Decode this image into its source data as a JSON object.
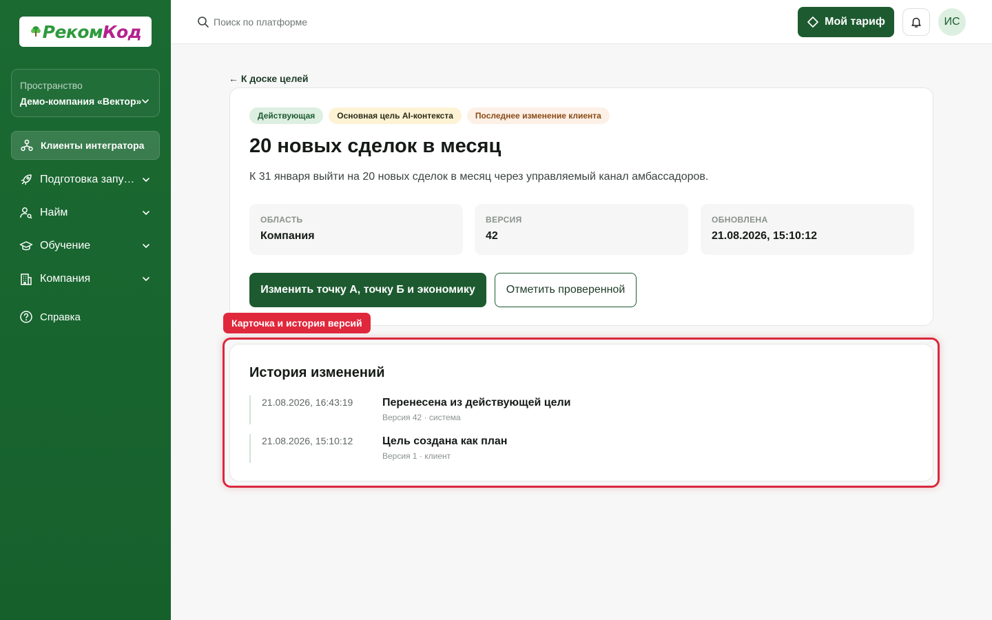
{
  "brand": {
    "logo_part1": "Реком",
    "logo_part2": "Код"
  },
  "sidebar": {
    "space_label": "Пространство",
    "space_value": "Демо-компания «Вектор»",
    "items": [
      {
        "label": "Клиенты интегратора",
        "icon": "users-network-icon",
        "active": true
      },
      {
        "label": "Подготовка запуска",
        "icon": "rocket-icon",
        "expandable": true
      },
      {
        "label": "Найм",
        "icon": "user-search-icon",
        "expandable": true
      },
      {
        "label": "Обучение",
        "icon": "graduation-cap-icon",
        "expandable": true
      },
      {
        "label": "Компания",
        "icon": "building-icon",
        "expandable": true
      },
      {
        "label": "Справка",
        "icon": "help-circle-icon"
      }
    ]
  },
  "topbar": {
    "search_placeholder": "Поиск по платформе",
    "tariff_label": "Мой тариф",
    "avatar_initials": "ИС"
  },
  "main": {
    "back_link": "← К доске целей",
    "badges": [
      "Действующая",
      "Основная цель AI-контекста",
      "Последнее изменение клиента"
    ],
    "title": "20 новых сделок в месяц",
    "description": "К 31 января выйти на 20 новых сделок в месяц через управляемый канал амбассадоров.",
    "info": [
      {
        "label": "ОБЛАСТЬ",
        "value": "Компания"
      },
      {
        "label": "ВЕРСИЯ",
        "value": "42"
      },
      {
        "label": "ОБНОВЛЕНА",
        "value": "21.08.2026, 15:10:12"
      }
    ],
    "primary_button": "Изменить точку А, точку Б и экономику",
    "secondary_button": "Отметить проверенной"
  },
  "highlight": {
    "tag": "Карточка и история версий"
  },
  "history": {
    "title": "История изменений",
    "entries": [
      {
        "time": "21.08.2026, 16:43:19",
        "title": "Перенесена из действующей цели",
        "meta": "Версия 42 · система"
      },
      {
        "time": "21.08.2026, 15:10:12",
        "title": "Цель создана как план",
        "meta": "Версия 1 · клиент"
      }
    ]
  },
  "colors": {
    "sidebar": "#1b6a32",
    "primary": "#1d5a30",
    "highlight": "#d9283c"
  }
}
